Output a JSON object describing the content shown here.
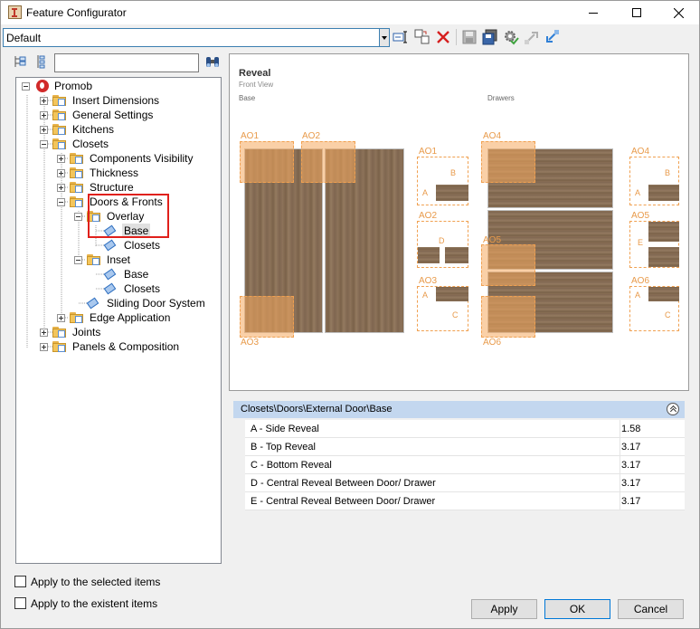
{
  "window": {
    "title": "Feature Configurator"
  },
  "toolbar": {
    "config_value": "Default"
  },
  "tree": {
    "search_value": "",
    "nodes": [
      {
        "label": "Promob"
      },
      {
        "label": "Insert Dimensions"
      },
      {
        "label": "General Settings"
      },
      {
        "label": "Kitchens"
      },
      {
        "label": "Closets"
      },
      {
        "label": "Components Visibility"
      },
      {
        "label": "Thickness"
      },
      {
        "label": "Structure"
      },
      {
        "label": "Doors & Fronts"
      },
      {
        "label": "Overlay"
      },
      {
        "label": "Base"
      },
      {
        "label": "Closets"
      },
      {
        "label": "Inset"
      },
      {
        "label": "Base"
      },
      {
        "label": "Closets"
      },
      {
        "label": "Sliding Door System"
      },
      {
        "label": "Edge Application"
      },
      {
        "label": "Joints"
      },
      {
        "label": "Panels & Composition"
      }
    ]
  },
  "preview": {
    "title": "Reveal",
    "subtitle": "Front View",
    "base_label": "Base",
    "drawers_label": "Drawers",
    "zones": {
      "ao1": "AO1",
      "ao2": "AO2",
      "ao3": "AO3",
      "ao4": "AO4",
      "ao5": "AO5",
      "ao6": "AO6"
    },
    "letters": {
      "a": "A",
      "b": "B",
      "c": "C",
      "d": "D",
      "e": "E"
    }
  },
  "properties": {
    "path": "Closets\\Doors\\External Door\\Base",
    "rows": [
      {
        "name": "A - Side Reveal",
        "value": "1.58"
      },
      {
        "name": "B - Top Reveal",
        "value": "3.17"
      },
      {
        "name": "C - Bottom Reveal",
        "value": "3.17"
      },
      {
        "name": "D - Central Reveal Between Door/ Drawer",
        "value": "3.17"
      },
      {
        "name": "E - Central Reveal Between Door/ Drawer",
        "value": "3.17"
      }
    ]
  },
  "options": {
    "apply_selected": "Apply to the selected items",
    "apply_existent": "Apply to the existent items"
  },
  "buttons": {
    "apply": "Apply",
    "ok": "OK",
    "cancel": "Cancel"
  }
}
